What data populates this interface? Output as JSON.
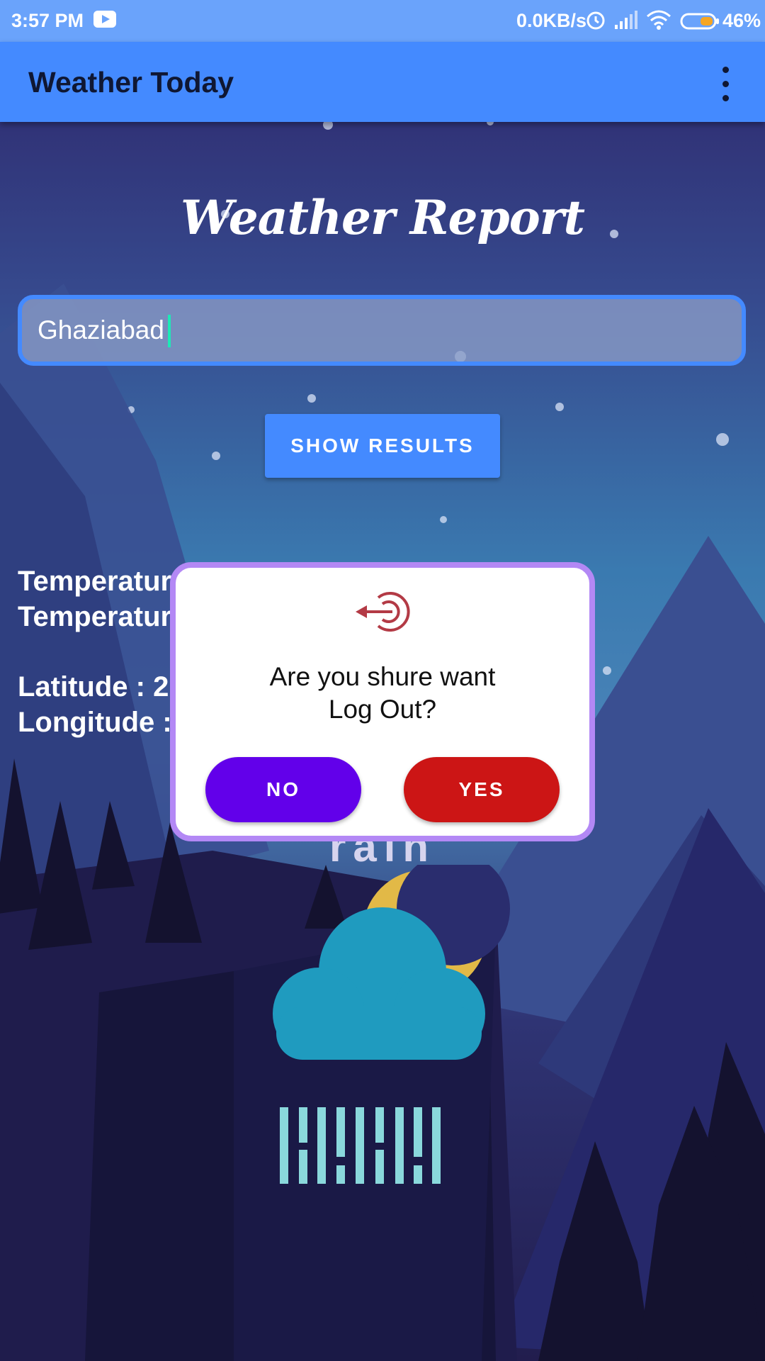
{
  "status_bar": {
    "time": "3:57 PM",
    "network_speed": "0.0KB/s",
    "battery_percent": "46%",
    "icons": [
      "youtube-icon",
      "alarm-icon",
      "signal-icon",
      "wifi-icon",
      "battery-icon"
    ]
  },
  "app_bar": {
    "title": "Weather Today",
    "menu_icon": "overflow-menu-icon"
  },
  "main": {
    "heading": "Weather Report",
    "city_input": {
      "value": "Ghaziabad",
      "placeholder": ""
    },
    "show_results_label": "SHOW RESULTS",
    "info_lines": [
      "Temperatur",
      "Temperatur",
      "Latitude : 2",
      "Longitude :"
    ],
    "condition": "rain",
    "condition_icon": "cloud-moon-rain-icon"
  },
  "dialog": {
    "icon": "logout-icon",
    "message_line1": "Are you shure want",
    "message_line2": "Log Out?",
    "no_label": "NO",
    "yes_label": "YES"
  },
  "colors": {
    "status_bar": "#6aa3fb",
    "app_bar": "#448aff",
    "no_button": "#6200ea",
    "yes_button": "#cc1515",
    "dialog_border": "#b388f5",
    "input_border": "#448aff",
    "cursor": "#1de9b6"
  }
}
